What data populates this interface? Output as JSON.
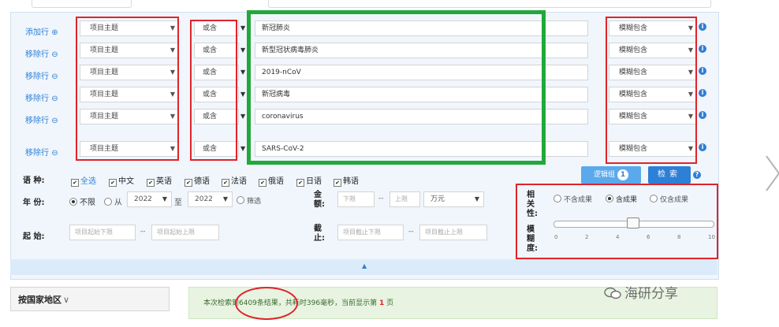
{
  "search_rows": [
    {
      "action": "添加行",
      "action_icon": "⊕",
      "field": "项目主题",
      "match": "或含",
      "value": "新冠肺炎",
      "fuzzy": "模糊包含"
    },
    {
      "action": "移除行",
      "action_icon": "⊖",
      "field": "项目主题",
      "match": "或含",
      "value": "新型冠状病毒肺炎",
      "fuzzy": "模糊包含"
    },
    {
      "action": "移除行",
      "action_icon": "⊖",
      "field": "项目主题",
      "match": "或含",
      "value": "2019-nCoV",
      "fuzzy": "模糊包含"
    },
    {
      "action": "移除行",
      "action_icon": "⊖",
      "field": "项目主题",
      "match": "或含",
      "value": "新冠病毒",
      "fuzzy": "模糊包含"
    },
    {
      "action": "移除行",
      "action_icon": "⊖",
      "field": "项目主题",
      "match": "或含",
      "value": "coronavirus",
      "fuzzy": "模糊包含"
    },
    {
      "action": "移除行",
      "action_icon": "⊖",
      "field": "项目主题",
      "match": "或含",
      "value": "SARS-CoV-2",
      "fuzzy": "模糊包含"
    }
  ],
  "language": {
    "label": "语  种:",
    "options": [
      "全选",
      "中文",
      "英语",
      "德语",
      "法语",
      "俄语",
      "日语",
      "韩语"
    ]
  },
  "logic_button": {
    "label": "逻辑组",
    "count": "1"
  },
  "search_button": "检索",
  "year": {
    "label": "年  份:",
    "opt_unlimited": "不限",
    "opt_from": "从",
    "from_value": "2022",
    "to_label": "至",
    "to_value": "2022",
    "filter": "筛选"
  },
  "amount": {
    "label": "金额:",
    "min_placeholder": "下限",
    "max_placeholder": "上限",
    "unit": "万元"
  },
  "relevance": {
    "label": "相关性:",
    "options": [
      "不含成果",
      "含成果",
      "仅含成果"
    ],
    "selected": "含成果"
  },
  "start": {
    "label": "起  始:",
    "min_placeholder": "项目起始下限",
    "max_placeholder": "项目起始上限"
  },
  "end": {
    "label": "截止:",
    "min_placeholder": "项目截止下限",
    "max_placeholder": "项目截止上限"
  },
  "fuzziness": {
    "label": "模糊度:",
    "ticks": [
      "0",
      "2",
      "4",
      "6",
      "8",
      "10"
    ],
    "value": 4
  },
  "country_button": "按国家地区",
  "result_text_prefix": "本次检索到6409条结果，共耗时396毫秒，当前显示第",
  "result_page": "1",
  "result_text_suffix": "页",
  "watermark": "海研分享",
  "colors": {
    "accent": "#2e7fd6",
    "highlight_red": "#e0232a",
    "highlight_green": "#22a83a"
  }
}
